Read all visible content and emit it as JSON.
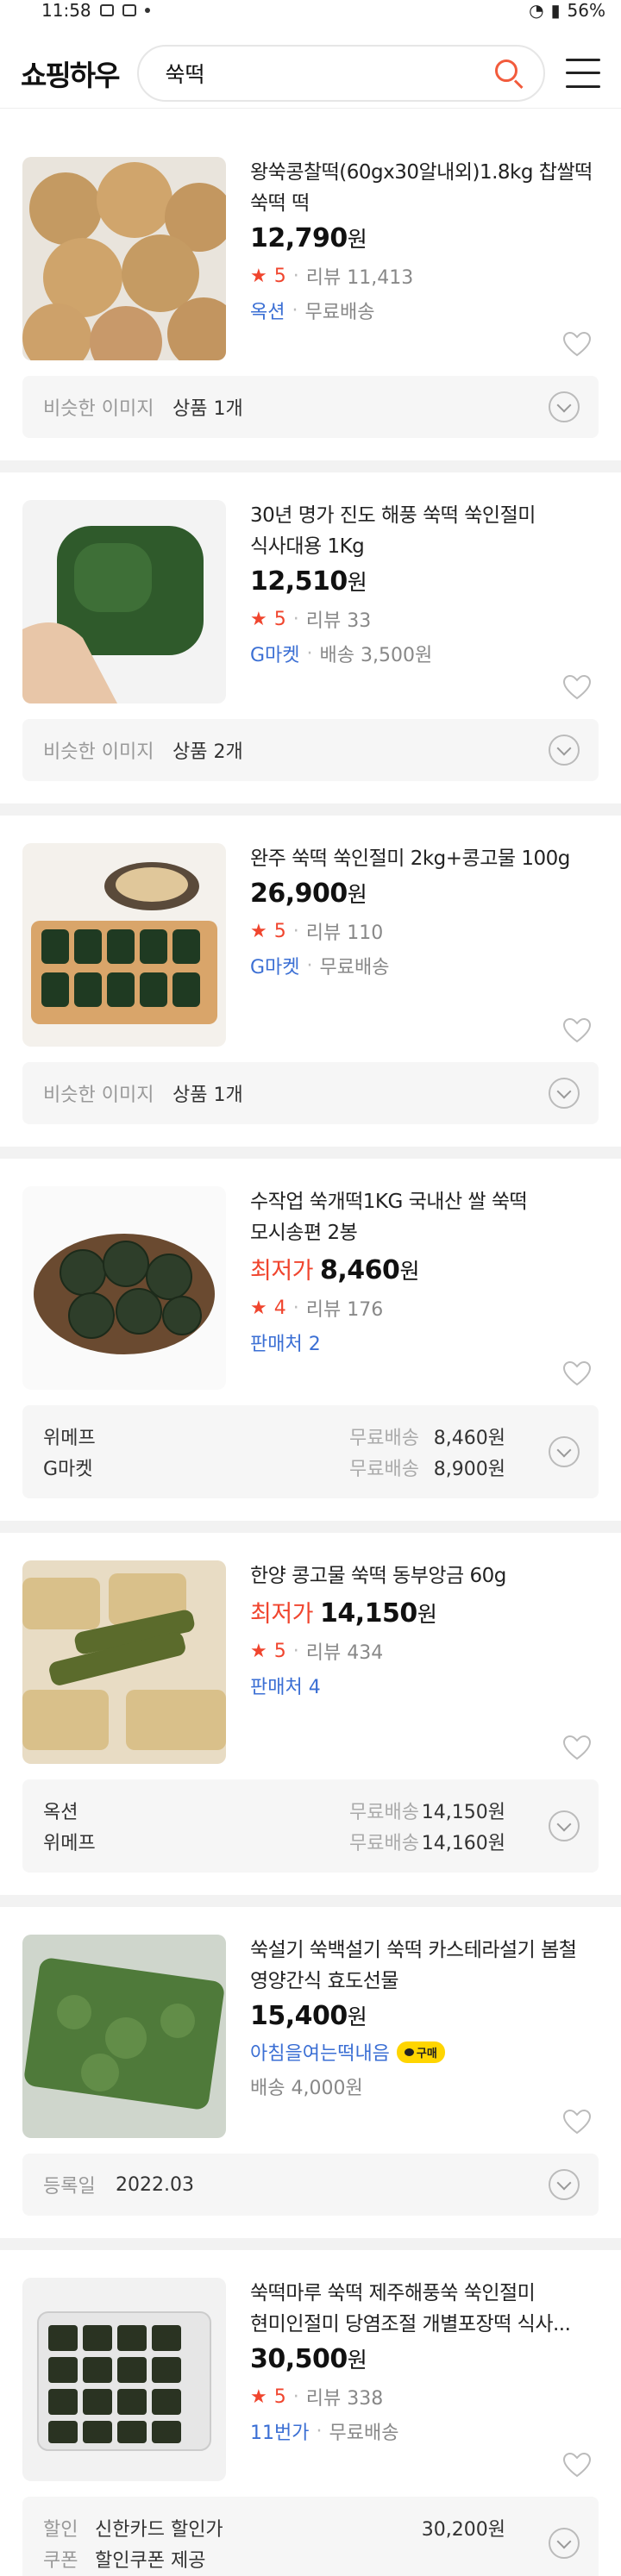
{
  "status_bar": {
    "time": "11:58",
    "battery": "56%"
  },
  "header": {
    "logo": "쇼핑하우",
    "search_value": "쑥떡"
  },
  "products": [
    {
      "title": "왕쑥콩찰떡(60gx30알내외)1.8kg 찹쌀떡 쑥떡 떡",
      "price": "12,790",
      "won": "원",
      "rating": "5",
      "reviews": "리뷰 11,413",
      "seller": "옥션",
      "shipping": "무료배송",
      "similar_label": "비슷한 이미지",
      "similar_value": "상품 1개"
    },
    {
      "title": "30년 명가 진도 해풍 쑥떡 쑥인절미 식사대용 1Kg",
      "price": "12,510",
      "won": "원",
      "rating": "5",
      "reviews": "리뷰 33",
      "seller": "G마켓",
      "shipping": "배송 3,500원",
      "similar_label": "비슷한 이미지",
      "similar_value": "상품 2개"
    },
    {
      "title": "완주 쑥떡 쑥인절미 2kg+콩고물 100g",
      "price": "26,900",
      "won": "원",
      "rating": "5",
      "reviews": "리뷰 110",
      "seller": "G마켓",
      "shipping": "무료배송",
      "similar_label": "비슷한 이미지",
      "similar_value": "상품 1개"
    },
    {
      "title": "수작업 쑥개떡1KG 국내산 쌀 쑥떡 모시송편 2봉",
      "lowest_label": "최저가",
      "price": "8,460",
      "won": "원",
      "rating": "4",
      "reviews": "리뷰 176",
      "sellers_count": "판매처 2",
      "stores": [
        {
          "name": "위메프",
          "ship": "무료배송",
          "price": "8,460원"
        },
        {
          "name": "G마켓",
          "ship": "무료배송",
          "price": "8,900원"
        }
      ]
    },
    {
      "title": "한양 콩고물 쑥떡 동부앙금 60g",
      "lowest_label": "최저가",
      "price": "14,150",
      "won": "원",
      "rating": "5",
      "reviews": "리뷰 434",
      "sellers_count": "판매처 4",
      "stores": [
        {
          "name": "옥션",
          "ship": "무료배송",
          "price": "14,150원"
        },
        {
          "name": "위메프",
          "ship": "무료배송",
          "price": "14,160원"
        }
      ]
    },
    {
      "title": "쑥설기 쑥백설기 쑥떡 카스테라설기 봄철 영양간식 효도선물",
      "price": "15,400",
      "won": "원",
      "seller": "아침을여는떡내음",
      "buy_badge": "구매",
      "shipping": "배송 4,000원",
      "reg_label": "등록일",
      "reg_value": "2022.03"
    },
    {
      "title": "쑥떡마루 쑥떡 제주해풍쑥 쑥인절미 현미인절미 당염조절 개별포장떡 식사...",
      "price": "30,500",
      "won": "원",
      "rating": "5",
      "reviews": "리뷰 338",
      "seller": "11번가",
      "shipping": "무료배송",
      "discount_label": "할인",
      "discount_value": "신한카드 할인가",
      "discount_price": "30,200원",
      "coupon_label": "쿠폰",
      "coupon_value": "할인쿠폰 제공"
    }
  ]
}
